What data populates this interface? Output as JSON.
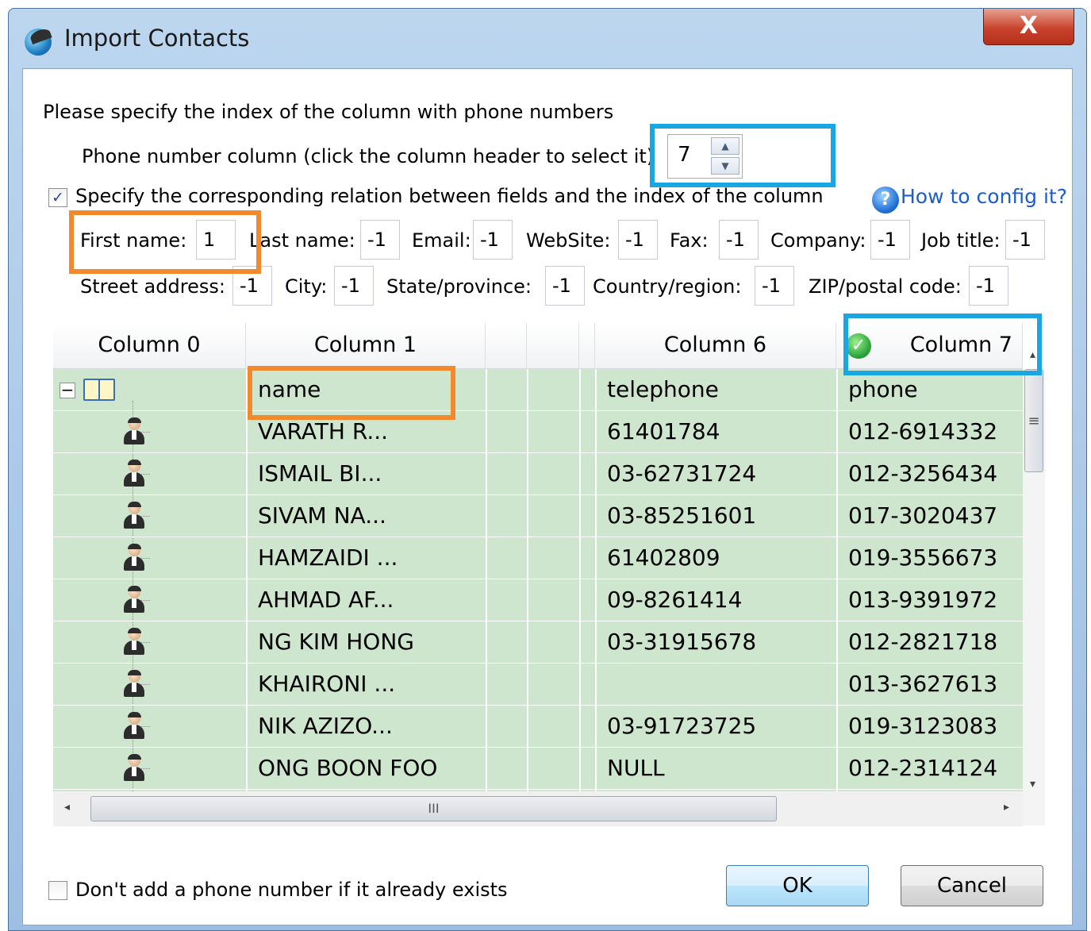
{
  "window": {
    "title": "Import Contacts",
    "close_label": "X"
  },
  "instructions": "Please specify the index of the column with phone numbers",
  "phone_column": {
    "label": "Phone number column (click the column header to select it)",
    "value": "7",
    "up": "▲",
    "down": "▼"
  },
  "relation": {
    "checked": "✓",
    "label": "Specify the corresponding relation between fields and the index of the column",
    "help_link": "How to config it?",
    "help_icon_glyph": "?"
  },
  "fields": [
    {
      "label": "First name:",
      "value": "1"
    },
    {
      "label": "Last name:",
      "value": "-1"
    },
    {
      "label": "Email:",
      "value": "-1"
    },
    {
      "label": "WebSite:",
      "value": "-1"
    },
    {
      "label": "Fax:",
      "value": "-1"
    },
    {
      "label": "Company:",
      "value": "-1"
    },
    {
      "label": "Job title:",
      "value": "-1"
    },
    {
      "label": "Street address:",
      "value": "-1"
    },
    {
      "label": "City:",
      "value": "-1"
    },
    {
      "label": "State/province:",
      "value": "-1"
    },
    {
      "label": "Country/region:",
      "value": "-1"
    },
    {
      "label": "ZIP/postal code:",
      "value": "-1"
    }
  ],
  "grid": {
    "headers": [
      "Column 0",
      "Column 1",
      "",
      "",
      "",
      "Column 6",
      "Column 7"
    ],
    "selected_check": "✓",
    "header_row": {
      "name": "name",
      "telephone": "telephone",
      "phone": "phone"
    },
    "rows": [
      {
        "name": "VARATH R...",
        "telephone": "61401784",
        "phone": "012-6914332"
      },
      {
        "name": "ISMAIL BI...",
        "telephone": "03-62731724",
        "phone": "012-3256434"
      },
      {
        "name": "SIVAM NA...",
        "telephone": "03-85251601",
        "phone": "017-3020437"
      },
      {
        "name": "HAMZAIDI ...",
        "telephone": "61402809",
        "phone": "019-3556673"
      },
      {
        "name": "AHMAD AF...",
        "telephone": "09-8261414",
        "phone": "013-9391972"
      },
      {
        "name": "NG KIM HONG",
        "telephone": "03-31915678",
        "phone": "012-2821718"
      },
      {
        "name": "KHAIRONI ...",
        "telephone": "",
        "phone": "013-3627613"
      },
      {
        "name": "NIK AZIZO...",
        "telephone": "03-91723725",
        "phone": "019-3123083"
      },
      {
        "name": "ONG BOON FOO",
        "telephone": "NULL",
        "phone": "012-2314124"
      }
    ],
    "collapse_glyph": "−",
    "hthumb_grip": "III",
    "vthumb_grip": "≡",
    "arrow_left": "◂",
    "arrow_right": "▸",
    "arrow_up": "▴",
    "arrow_down": "▾"
  },
  "footer": {
    "skip_existing_label": "Don't add a phone number if it already exists",
    "ok_label": "OK",
    "cancel_label": "Cancel"
  },
  "colors": {
    "highlight_blue": "#19a6e1",
    "highlight_orange": "#f18a2d",
    "row_green": "#cde6cd"
  }
}
